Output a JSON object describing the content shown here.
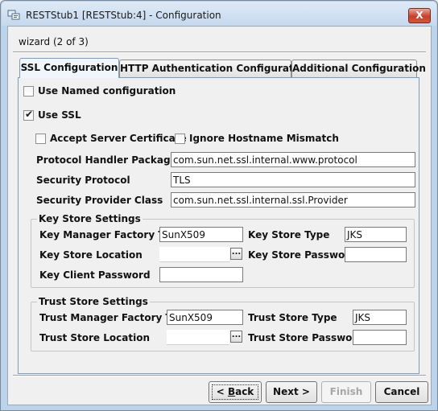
{
  "window": {
    "title": "RESTStub1 [RESTStub:4] - Configuration",
    "close_glyph": "X"
  },
  "wizard": {
    "title": "wizard (2 of 3)"
  },
  "tabs": [
    {
      "label": "SSL Configuration",
      "selected": true
    },
    {
      "label": "HTTP Authentication Configuration",
      "selected": false
    },
    {
      "label": "Additional Configuration",
      "selected": false
    }
  ],
  "ssl": {
    "use_named_configuration": {
      "label": "Use Named configuration",
      "checked": false
    },
    "use_ssl": {
      "label": "Use SSL",
      "checked": true,
      "mark": "✔"
    },
    "accept_server_certificate": {
      "label": "Accept Server Certificate",
      "checked": false
    },
    "ignore_hostname_mismatch": {
      "label": "Ignore Hostname Mismatch",
      "checked": false
    },
    "protocol_handler_packages": {
      "label": "Protocol Handler Packages",
      "value": "com.sun.net.ssl.internal.www.protocol"
    },
    "security_protocol": {
      "label": "Security Protocol",
      "value": "TLS"
    },
    "security_provider_class": {
      "label": "Security Provider Class",
      "value": "com.sun.net.ssl.internal.ssl.Provider"
    }
  },
  "key_store": {
    "title": "Key Store Settings",
    "manager_factory_type": {
      "label": "Key Manager Factory Type",
      "value": "SunX509"
    },
    "store_type": {
      "label": "Key Store Type",
      "value": "JKS"
    },
    "location": {
      "label": "Key Store Location",
      "value": "",
      "browse_glyph": "..."
    },
    "store_password": {
      "label": "Key Store Password",
      "value": ""
    },
    "client_password": {
      "label": "Key Client Password",
      "value": ""
    }
  },
  "trust_store": {
    "title": "Trust Store Settings",
    "manager_factory_type": {
      "label": "Trust Manager Factory Type",
      "value": "SunX509"
    },
    "store_type": {
      "label": "Trust Store Type",
      "value": "JKS"
    },
    "location": {
      "label": "Trust Store Location",
      "value": "",
      "browse_glyph": "..."
    },
    "store_password": {
      "label": "Trust Store Password",
      "value": ""
    }
  },
  "buttons": {
    "back": {
      "prefix": "< ",
      "mnemonic": "B",
      "rest": "ack",
      "enabled": true
    },
    "next": {
      "label": "Next >",
      "enabled": true
    },
    "finish": {
      "label": "Finish",
      "enabled": false
    },
    "cancel": {
      "label": "Cancel",
      "enabled": true
    }
  }
}
